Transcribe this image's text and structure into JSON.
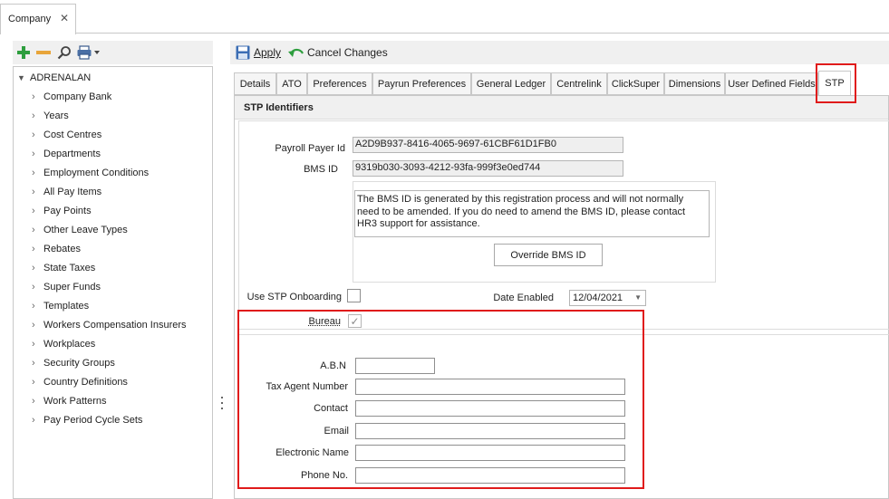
{
  "doc_tab": {
    "label": "Company",
    "close_glyph": "✕"
  },
  "left_toolbar": {
    "icons": [
      "add-icon",
      "remove-icon",
      "search-icon",
      "print-icon"
    ]
  },
  "tree": {
    "root": "ADRENALAN",
    "items": [
      "Company Bank",
      "Years",
      "Cost Centres",
      "Departments",
      "Employment Conditions",
      "All Pay Items",
      "Pay Points",
      "Other Leave Types",
      "Rebates",
      "State Taxes",
      "Super Funds",
      "Templates",
      "Workers Compensation Insurers",
      "Workplaces",
      "Security Groups",
      "Country Definitions",
      "Work Patterns",
      "Pay Period Cycle Sets"
    ]
  },
  "action_bar": {
    "apply": "Apply",
    "cancel": "Cancel Changes"
  },
  "tabs": [
    "Details",
    "ATO",
    "Preferences",
    "Payrun Preferences",
    "General Ledger",
    "Centrelink",
    "ClickSuper",
    "Dimensions",
    "User Defined Fields",
    "STP"
  ],
  "active_tab": "STP",
  "section": {
    "title": "STP Identifiers"
  },
  "fields": {
    "payroll_payer_id": {
      "label": "Payroll Payer Id",
      "value": "A2D9B937-8416-4065-9697-61CBF61D1FB0"
    },
    "bms_id": {
      "label": "BMS ID",
      "value": "9319b030-3093-4212-93fa-999f3e0ed744"
    },
    "bms_info": "The BMS ID is generated by this registration process and will not normally need to be amended. If you do need to amend the BMS ID, please contact HR3 support for assistance.",
    "override_button": "Override BMS ID",
    "use_stp_onboarding": {
      "label": "Use STP Onboarding",
      "checked": false
    },
    "date_enabled": {
      "label": "Date Enabled",
      "value": "12/04/2021"
    },
    "bureau": {
      "label": "Bureau",
      "checked": true
    },
    "abn": {
      "label": "A.B.N",
      "value": ""
    },
    "tax_agent_number": {
      "label": "Tax Agent Number",
      "value": ""
    },
    "contact": {
      "label": "Contact",
      "value": ""
    },
    "email": {
      "label": "Email",
      "value": ""
    },
    "electronic_name": {
      "label": "Electronic Name",
      "value": ""
    },
    "phone_no": {
      "label": "Phone No.",
      "value": ""
    }
  },
  "colors": {
    "highlight": "#e01b1b",
    "panel_bg": "#f0f0f0",
    "add_icon": "#2e9e3e",
    "remove_icon": "#e8a53a"
  }
}
